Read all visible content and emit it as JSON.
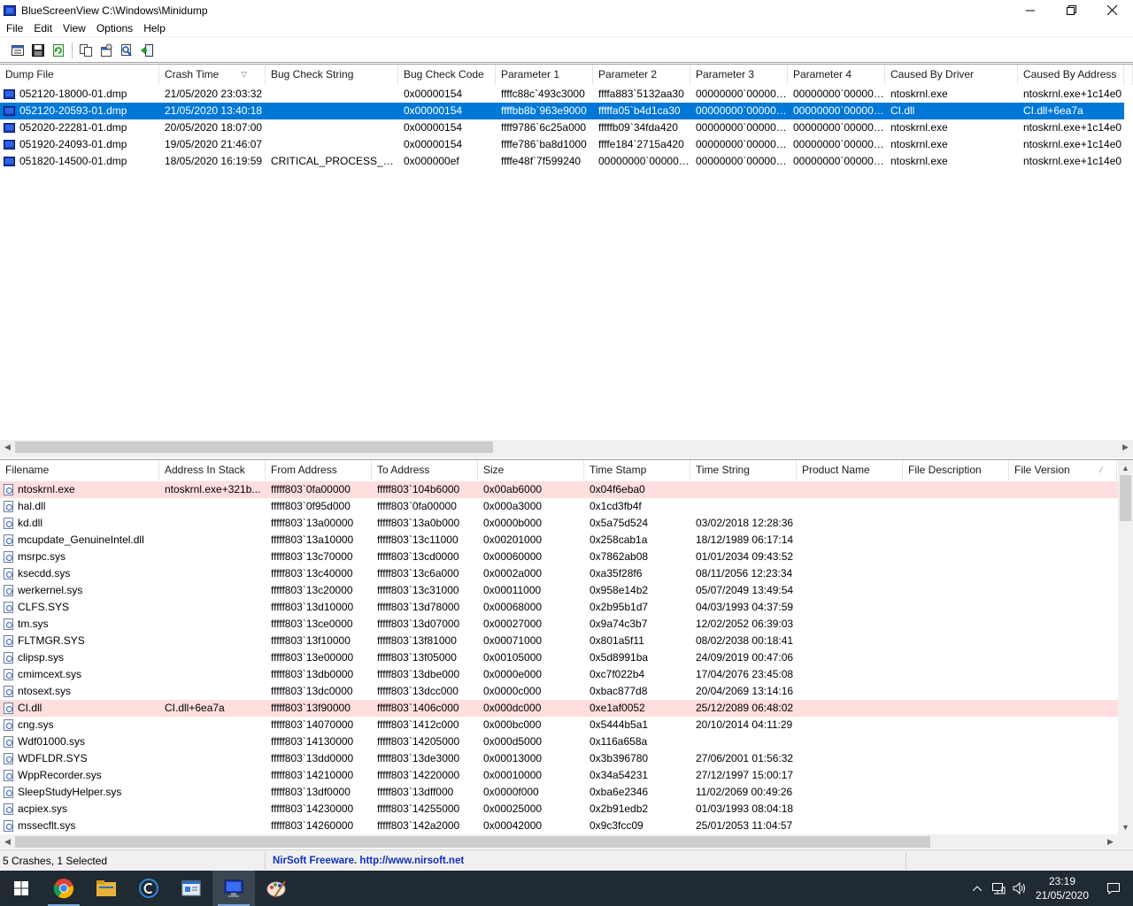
{
  "window": {
    "title": "BlueScreenView    C:\\Windows\\Minidump"
  },
  "menu": [
    "File",
    "Edit",
    "View",
    "Options",
    "Help"
  ],
  "toolbar_icons": [
    "properties-icon",
    "save-icon",
    "refresh-icon",
    "copy-icon",
    "options-icon",
    "find-icon",
    "exit-icon"
  ],
  "crashes": {
    "columns": [
      "Dump File",
      "Crash Time",
      "Bug Check String",
      "Bug Check Code",
      "Parameter 1",
      "Parameter 2",
      "Parameter 3",
      "Parameter 4",
      "Caused By Driver",
      "Caused By Address"
    ],
    "sort_glyph": "▽",
    "rows": [
      [
        "052120-18000-01.dmp",
        "21/05/2020 23:03:32",
        "",
        "0x00000154",
        "ffffc88c`493c3000",
        "ffffa883`5132aa30",
        "00000000`000000...",
        "00000000`000000...",
        "ntoskrnl.exe",
        "ntoskrnl.exe+1c14e0"
      ],
      [
        "052120-20593-01.dmp",
        "21/05/2020 13:40:18",
        "",
        "0x00000154",
        "ffffbb8b`963e9000",
        "fffffa05`b4d1ca30",
        "00000000`000000...",
        "00000000`000000...",
        "CI.dll",
        "CI.dll+6ea7a"
      ],
      [
        "052020-22281-01.dmp",
        "20/05/2020 18:07:00",
        "",
        "0x00000154",
        "ffff9786`6c25a000",
        "fffffb09`34fda420",
        "00000000`000000...",
        "00000000`000000...",
        "ntoskrnl.exe",
        "ntoskrnl.exe+1c14e0"
      ],
      [
        "051920-24093-01.dmp",
        "19/05/2020 21:46:07",
        "",
        "0x00000154",
        "ffffe786`ba8d1000",
        "ffffe184`2715a420",
        "00000000`000000...",
        "00000000`000000...",
        "ntoskrnl.exe",
        "ntoskrnl.exe+1c14e0"
      ],
      [
        "051820-14500-01.dmp",
        "18/05/2020 16:19:59",
        "CRITICAL_PROCESS_DIED",
        "0x000000ef",
        "ffffe48f`7f599240",
        "00000000`000000...",
        "00000000`000000...",
        "00000000`000000...",
        "ntoskrnl.exe",
        "ntoskrnl.exe+1c14e0"
      ]
    ]
  },
  "modules": {
    "columns": [
      "Filename",
      "Address In Stack",
      "From Address",
      "To Address",
      "Size",
      "Time Stamp",
      "Time String",
      "Product Name",
      "File Description",
      "File Version"
    ],
    "sort_glyph": "⁄",
    "rows": [
      [
        "ntoskrnl.exe",
        "ntoskrnl.exe+321b...",
        "fffff803`0fa00000",
        "fffff803`104b6000",
        "0x00ab6000",
        "0x04f6eba0",
        ""
      ],
      [
        "hal.dll",
        "",
        "fffff803`0f95d000",
        "fffff803`0fa00000",
        "0x000a3000",
        "0x1cd3fb4f",
        ""
      ],
      [
        "kd.dll",
        "",
        "fffff803`13a00000",
        "fffff803`13a0b000",
        "0x0000b000",
        "0x5a75d524",
        "03/02/2018 12:28:36"
      ],
      [
        "mcupdate_GenuineIntel.dll",
        "",
        "fffff803`13a10000",
        "fffff803`13c11000",
        "0x00201000",
        "0x258cab1a",
        "18/12/1989 06:17:14"
      ],
      [
        "msrpc.sys",
        "",
        "fffff803`13c70000",
        "fffff803`13cd0000",
        "0x00060000",
        "0x7862ab08",
        "01/01/2034 09:43:52"
      ],
      [
        "ksecdd.sys",
        "",
        "fffff803`13c40000",
        "fffff803`13c6a000",
        "0x0002a000",
        "0xa35f28f6",
        "08/11/2056 12:23:34"
      ],
      [
        "werkernel.sys",
        "",
        "fffff803`13c20000",
        "fffff803`13c31000",
        "0x00011000",
        "0x958e14b2",
        "05/07/2049 13:49:54"
      ],
      [
        "CLFS.SYS",
        "",
        "fffff803`13d10000",
        "fffff803`13d78000",
        "0x00068000",
        "0x2b95b1d7",
        "04/03/1993 04:37:59"
      ],
      [
        "tm.sys",
        "",
        "fffff803`13ce0000",
        "fffff803`13d07000",
        "0x00027000",
        "0x9a74c3b7",
        "12/02/2052 06:39:03"
      ],
      [
        "FLTMGR.SYS",
        "",
        "fffff803`13f10000",
        "fffff803`13f81000",
        "0x00071000",
        "0x801a5f11",
        "08/02/2038 00:18:41"
      ],
      [
        "clipsp.sys",
        "",
        "fffff803`13e00000",
        "fffff803`13f05000",
        "0x00105000",
        "0x5d8991ba",
        "24/09/2019 00:47:06"
      ],
      [
        "cmimcext.sys",
        "",
        "fffff803`13db0000",
        "fffff803`13dbe000",
        "0x0000e000",
        "0xc7f022b4",
        "17/04/2076 23:45:08"
      ],
      [
        "ntosext.sys",
        "",
        "fffff803`13dc0000",
        "fffff803`13dcc000",
        "0x0000c000",
        "0xbac877d8",
        "20/04/2069 13:14:16"
      ],
      [
        "CI.dll",
        "CI.dll+6ea7a",
        "fffff803`13f90000",
        "fffff803`1406c000",
        "0x000dc000",
        "0xe1af0052",
        "25/12/2089 06:48:02"
      ],
      [
        "cng.sys",
        "",
        "fffff803`14070000",
        "fffff803`1412c000",
        "0x000bc000",
        "0x5444b5a1",
        "20/10/2014 04:11:29"
      ],
      [
        "Wdf01000.sys",
        "",
        "fffff803`14130000",
        "fffff803`14205000",
        "0x000d5000",
        "0x116a658a",
        ""
      ],
      [
        "WDFLDR.SYS",
        "",
        "fffff803`13dd0000",
        "fffff803`13de3000",
        "0x00013000",
        "0x3b396780",
        "27/06/2001 01:56:32"
      ],
      [
        "WppRecorder.sys",
        "",
        "fffff803`14210000",
        "fffff803`14220000",
        "0x00010000",
        "0x34a54231",
        "27/12/1997 15:00:17"
      ],
      [
        "SleepStudyHelper.sys",
        "",
        "fffff803`13df0000",
        "fffff803`13dff000",
        "0x0000f000",
        "0xba6e2346",
        "11/02/2069 00:49:26"
      ],
      [
        "acpiex.sys",
        "",
        "fffff803`14230000",
        "fffff803`14255000",
        "0x00025000",
        "0x2b91edb2",
        "01/03/1993 08:04:18"
      ],
      [
        "mssecflt.sys",
        "",
        "fffff803`14260000",
        "fffff803`142a2000",
        "0x00042000",
        "0x9c3fcc09",
        "25/01/2053 11:04:57"
      ]
    ]
  },
  "status": {
    "count": "5 Crashes, 1 Selected",
    "nirsoft": "NirSoft Freeware.  http://www.nirsoft.net"
  },
  "taskbar": {
    "apps": [
      "windows-start-icon",
      "chrome-icon",
      "file-explorer-icon",
      "ccleaner-icon",
      "app-window-icon",
      "bluescreenview-icon",
      "paint-icon"
    ],
    "time": "23:19",
    "date": "21/05/2020"
  }
}
